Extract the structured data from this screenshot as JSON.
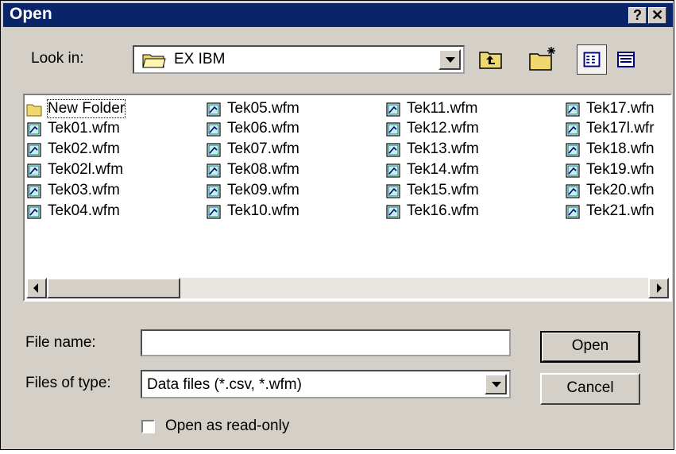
{
  "dialog": {
    "title": "Open",
    "help_button": "?",
    "close_button": "✕"
  },
  "look_in": {
    "label": "Look in:",
    "value": "EX IBM"
  },
  "files": [
    {
      "name": "New Folder",
      "type": "folder"
    },
    {
      "name": "Tek01.wfm",
      "type": "file"
    },
    {
      "name": "Tek02.wfm",
      "type": "file"
    },
    {
      "name": "Tek02l.wfm",
      "type": "file"
    },
    {
      "name": "Tek03.wfm",
      "type": "file"
    },
    {
      "name": "Tek04.wfm",
      "type": "file"
    },
    {
      "name": "Tek05.wfm",
      "type": "file"
    },
    {
      "name": "Tek06.wfm",
      "type": "file"
    },
    {
      "name": "Tek07.wfm",
      "type": "file"
    },
    {
      "name": "Tek08.wfm",
      "type": "file"
    },
    {
      "name": "Tek09.wfm",
      "type": "file"
    },
    {
      "name": "Tek10.wfm",
      "type": "file"
    },
    {
      "name": "Tek11.wfm",
      "type": "file"
    },
    {
      "name": "Tek12.wfm",
      "type": "file"
    },
    {
      "name": "Tek13.wfm",
      "type": "file"
    },
    {
      "name": "Tek14.wfm",
      "type": "file"
    },
    {
      "name": "Tek15.wfm",
      "type": "file"
    },
    {
      "name": "Tek16.wfm",
      "type": "file"
    },
    {
      "name": "Tek17.wfn",
      "type": "file"
    },
    {
      "name": "Tek17l.wfr",
      "type": "file"
    },
    {
      "name": "Tek18.wfn",
      "type": "file"
    },
    {
      "name": "Tek19.wfn",
      "type": "file"
    },
    {
      "name": "Tek20.wfn",
      "type": "file"
    },
    {
      "name": "Tek21.wfn",
      "type": "file"
    }
  ],
  "file_name": {
    "label": "File name:",
    "value": ""
  },
  "file_type": {
    "label": "Files of type:",
    "value": "Data files (*.csv, *.wfm)"
  },
  "buttons": {
    "open": "Open",
    "cancel": "Cancel"
  },
  "read_only": {
    "label": "Open as read-only",
    "checked": false
  },
  "colors": {
    "titlebar": "#0a246a",
    "face": "#d4d0c8"
  }
}
